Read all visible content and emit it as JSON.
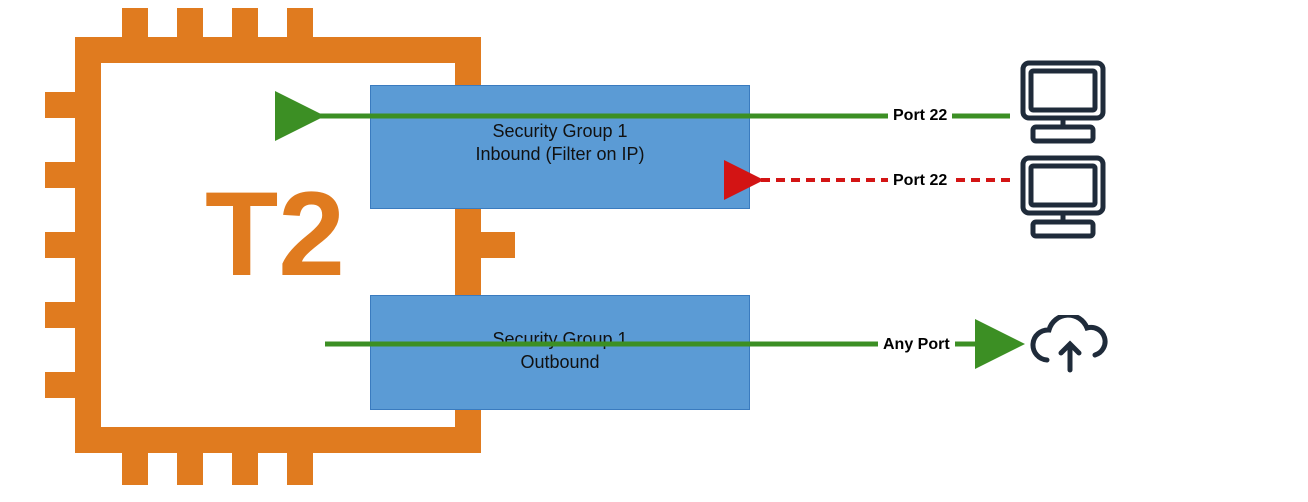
{
  "instance_label": "T2",
  "sg_inbound": {
    "title_line1": "Security Group 1",
    "title_line2": "Inbound (Filter on IP)"
  },
  "sg_outbound": {
    "title_line1": "Security Group 1",
    "title_line2": "Outbound"
  },
  "labels": {
    "port_allowed": "Port 22",
    "port_denied": "Port 22",
    "port_outbound": "Any Port"
  },
  "colors": {
    "chip": "#e07b1f",
    "box": "#5b9bd5",
    "allow": "#3c8f24",
    "deny": "#d31414",
    "icon": "#1f2b3a"
  }
}
